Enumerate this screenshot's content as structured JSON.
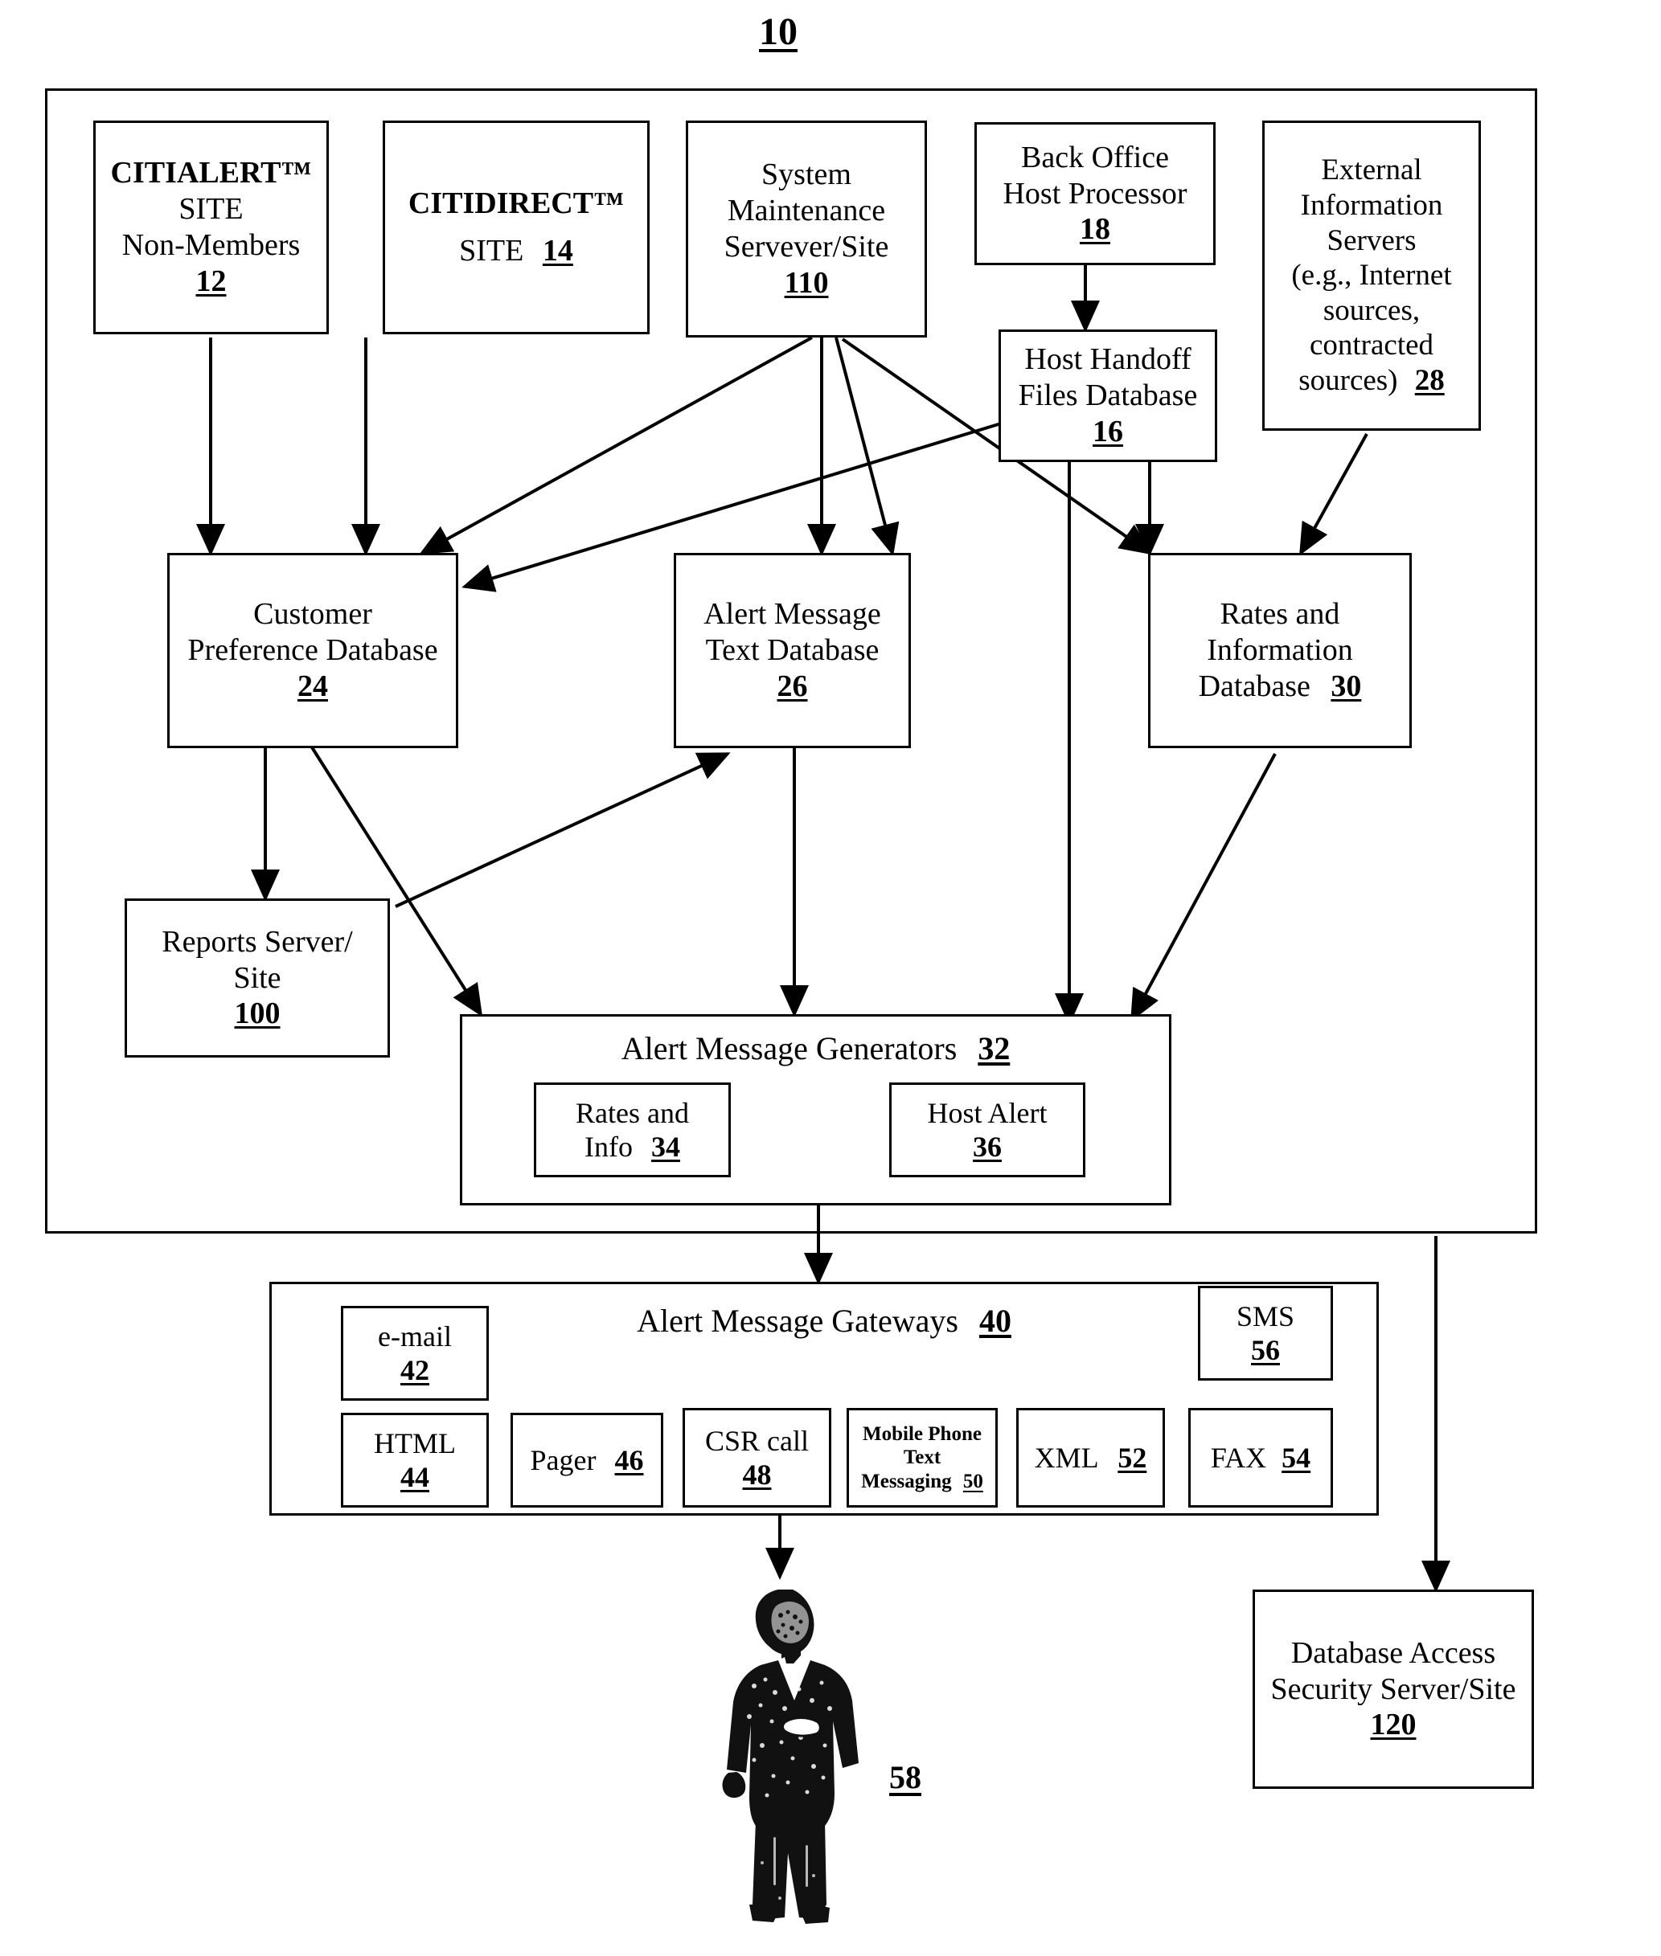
{
  "figure": {
    "number": "10"
  },
  "nodes": {
    "citialert": {
      "line1": "CITIALERT™",
      "line2": "SITE",
      "line3": "Non-Members",
      "ref": "12"
    },
    "citidirect": {
      "line1": "CITIDIRECT™",
      "line2": "SITE",
      "ref": "14"
    },
    "system_maintenance": {
      "line1": "System",
      "line2": "Maintenance",
      "line3": "Servever/Site",
      "ref": "110"
    },
    "back_office": {
      "line1": "Back Office",
      "line2": "Host Processor",
      "ref": "18"
    },
    "external_info": {
      "line1": "External",
      "line2": "Information",
      "line3": "Servers",
      "line4": "(e.g., Internet",
      "line5": "sources,",
      "line6": "contracted",
      "line7": "sources)",
      "ref": "28"
    },
    "host_handoff": {
      "line1": "Host Handoff",
      "line2": "Files Database",
      "ref": "16"
    },
    "customer_pref": {
      "line1": "Customer",
      "line2": "Preference Database",
      "ref": "24"
    },
    "alert_text": {
      "line1": "Alert Message",
      "line2": "Text Database",
      "ref": "26"
    },
    "rates_info_db": {
      "line1": "Rates and",
      "line2": "Information",
      "line3": "Database",
      "ref": "30"
    },
    "reports_server": {
      "line1": "Reports Server/",
      "line2": "Site",
      "ref": "100"
    },
    "alert_generators": {
      "title": "Alert Message Generators",
      "ref": "32",
      "children": [
        {
          "line1": "Rates and",
          "line2": "Info",
          "ref": "34"
        },
        {
          "line1": "Host Alert",
          "ref": "36"
        }
      ]
    },
    "alert_gateways": {
      "title": "Alert Message Gateways",
      "ref": "40",
      "children": [
        {
          "line1": "e-mail",
          "ref": "42"
        },
        {
          "line1": "SMS",
          "ref": "56"
        },
        {
          "line1": "HTML",
          "ref": "44"
        },
        {
          "line1": "Pager",
          "ref": "46"
        },
        {
          "line1": "CSR call",
          "ref": "48"
        },
        {
          "line1": "Mobile Phone",
          "line2": "Text",
          "line3": "Messaging",
          "ref": "50"
        },
        {
          "line1": "XML",
          "ref": "52"
        },
        {
          "line1": "FAX",
          "ref": "54"
        }
      ]
    },
    "db_security": {
      "line1": "Database Access",
      "line2": "Security Server/Site",
      "ref": "120"
    },
    "customer_person": {
      "icon": "person-figure",
      "ref": "58"
    }
  },
  "colors": {
    "ink": "#000000",
    "paper": "#ffffff"
  }
}
